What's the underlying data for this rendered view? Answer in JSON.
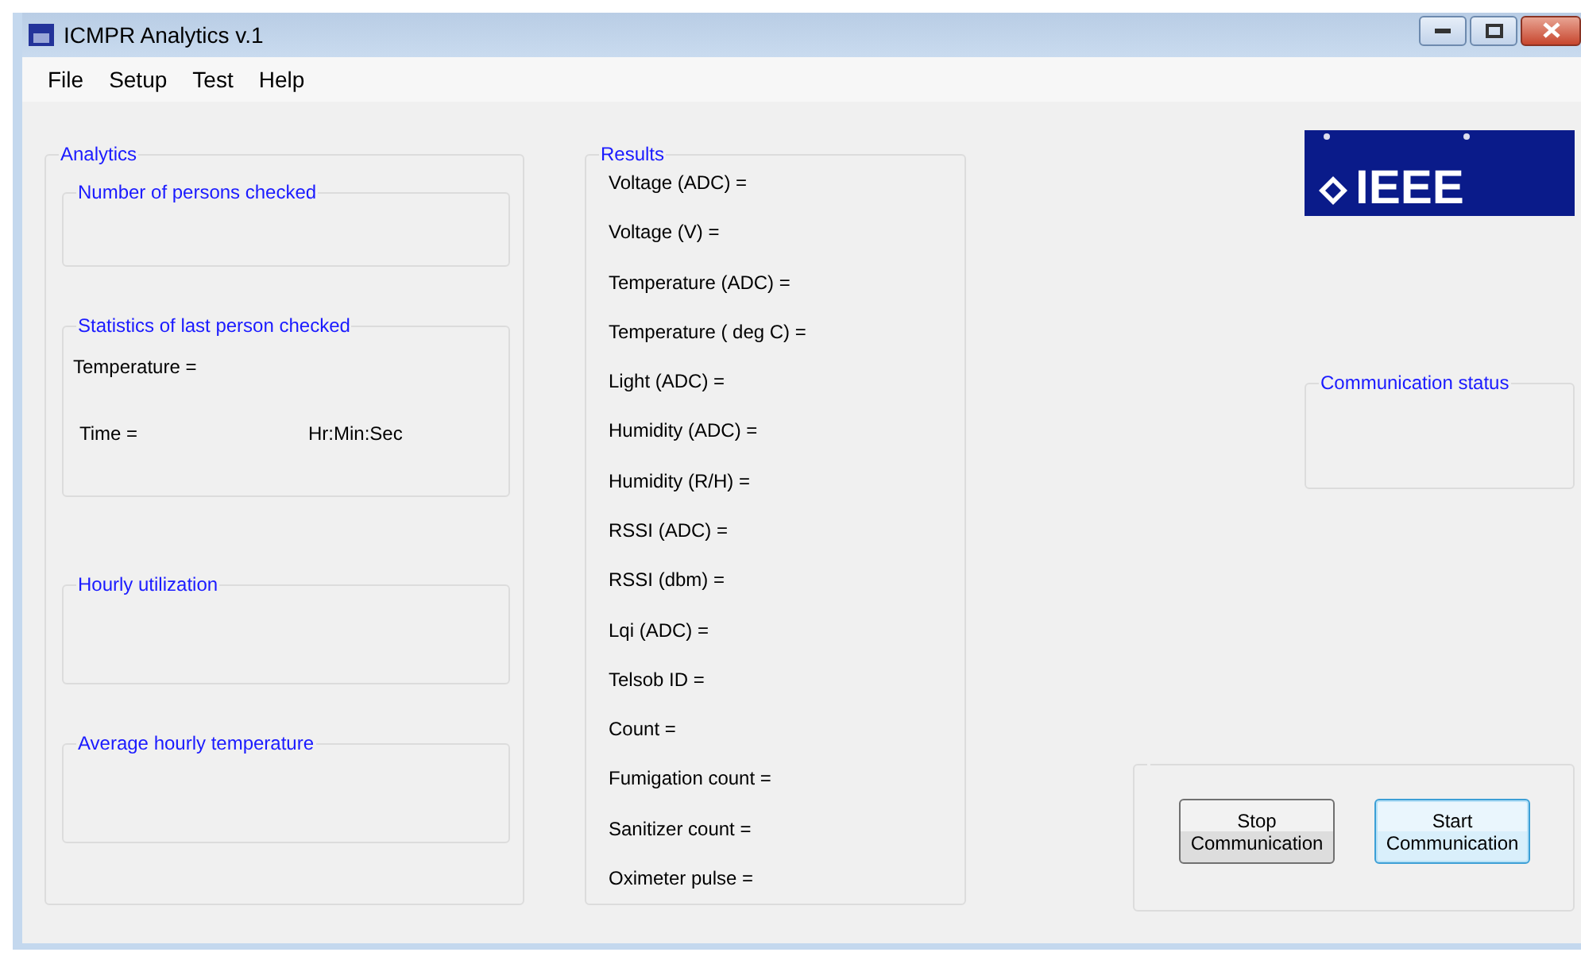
{
  "window": {
    "title": "ICMPR Analytics v.1"
  },
  "menu": [
    "File",
    "Setup",
    "Test",
    "Help"
  ],
  "analytics": {
    "title": "Analytics",
    "groups": [
      {
        "kind": "empty",
        "title": "Number of persons checked"
      },
      {
        "kind": "stats",
        "title": "Statistics of last person checked",
        "temperature_label": "Temperature =",
        "time_label": "Time =",
        "time_unit": "Hr:Min:Sec"
      },
      {
        "kind": "empty",
        "title": "Hourly utilization"
      },
      {
        "kind": "empty",
        "title": "Average hourly temperature"
      }
    ]
  },
  "results": {
    "title": "Results",
    "items": [
      "Voltage (ADC) =",
      "Voltage (V) =",
      "Temperature (ADC) =",
      "Temperature ( deg C) =",
      "Light (ADC) =",
      "Humidity (ADC) =",
      "Humidity (R/H) =",
      "RSSI (ADC) =",
      "RSSI (dbm) =",
      "Lqi (ADC) =",
      "Telsob ID =",
      "Count =",
      "Fumigation count =",
      "Sanitizer count =",
      "Oximeter pulse ="
    ]
  },
  "logo": {
    "text": "IEEE"
  },
  "communication_status": {
    "title": "Communication status"
  },
  "buttons": [
    {
      "label": "Stop Communication",
      "focused": false
    },
    {
      "label": "Start Communication",
      "focused": true
    }
  ]
}
